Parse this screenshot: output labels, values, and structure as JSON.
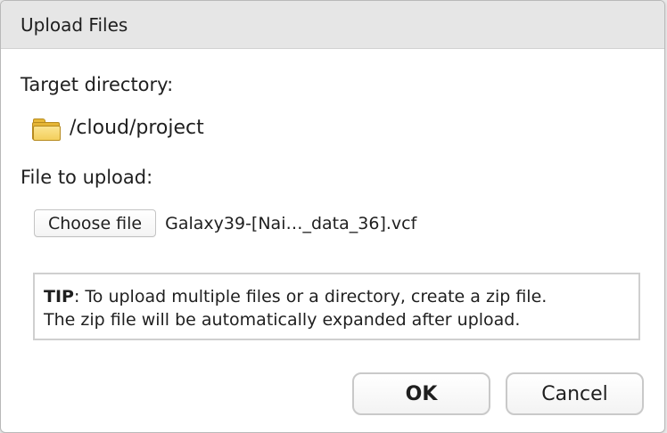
{
  "dialog": {
    "title": "Upload Files",
    "target_label": "Target directory:",
    "target_path": "/cloud/project",
    "target_icon": "folder-icon",
    "file_label": "File to upload:",
    "choose_button": "Choose file",
    "selected_file": "Galaxy39-[Nai…_data_36].vcf",
    "tip": {
      "prefix": "TIP",
      "line1": ": To upload multiple files or a directory, create a zip file.",
      "line2": "The zip file will be automatically expanded after upload."
    },
    "ok_label": "OK",
    "cancel_label": "Cancel"
  }
}
